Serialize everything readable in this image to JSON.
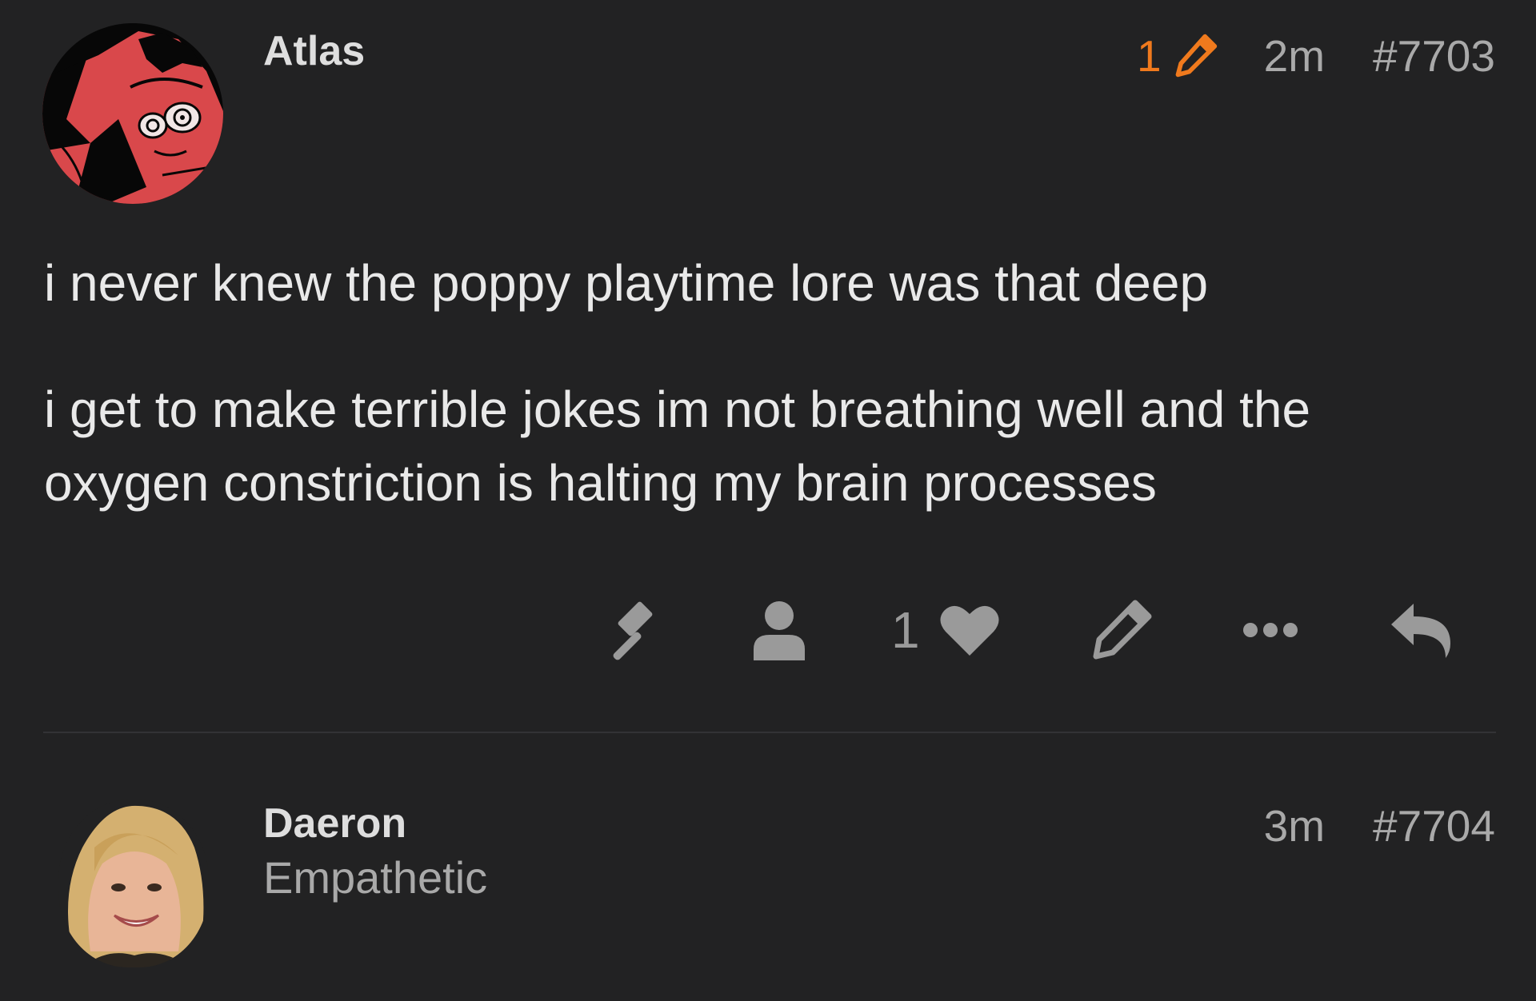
{
  "posts": [
    {
      "username": "Atlas",
      "edit_count": "1",
      "time": "2m",
      "post_number": "#7703",
      "avatar_icon": "red-anime-character-avatar",
      "paragraphs": [
        "i never knew the poppy playtime lore was that deep",
        "i get to make terrible jokes im not breathing well and the oxygen constriction is halting my brain processes"
      ],
      "actions": {
        "moderate_icon": "gavel-icon",
        "user_icon": "user-icon",
        "like_count": "1",
        "like_icon": "heart-icon",
        "edit_icon": "pencil-icon",
        "more_icon": "ellipsis-icon",
        "reply_icon": "reply-icon"
      }
    },
    {
      "username": "Daeron",
      "user_title": "Empathetic",
      "time": "3m",
      "post_number": "#7704",
      "avatar_icon": "photo-avatar"
    }
  ],
  "colors": {
    "background": "#222223",
    "text": "#e9e9e9",
    "muted": "#a9a9a9",
    "icon": "#9a9a9a",
    "edit_accent": "#f07a1d",
    "divider": "#333335"
  }
}
